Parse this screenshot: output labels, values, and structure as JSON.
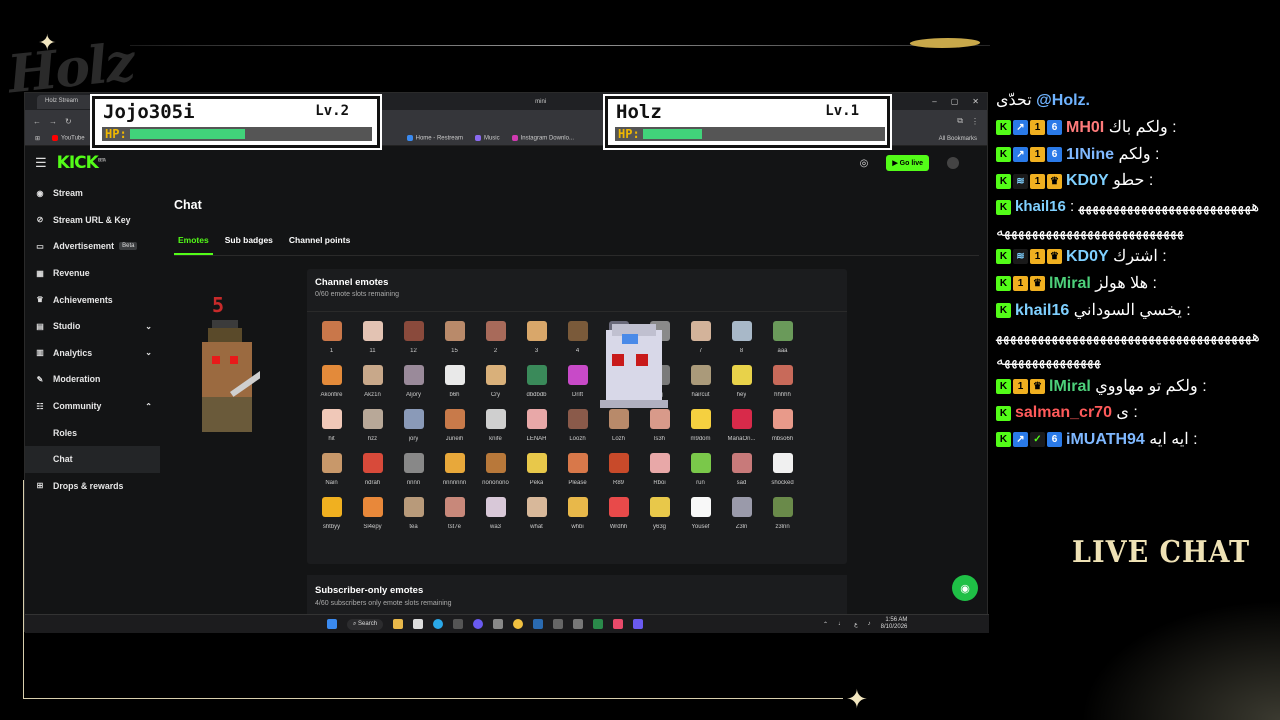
{
  "overlay": {
    "logo_text": "Holz",
    "live_chat_label": "LIVE CHAT",
    "player1": {
      "name": "Jojo305i",
      "level": "Lv.2",
      "hp_label": "HP:",
      "hp_fraction": 0.5
    },
    "player2": {
      "name": "Holz",
      "level": "Lv.1",
      "hp_label": "HP:",
      "hp_fraction": 0.26
    },
    "warrior_number": "5"
  },
  "browser": {
    "tab_title": "Holz Stream",
    "other_tab": "mini",
    "bookmarks": [
      "YouTube",
      "Home - Restream",
      "Music",
      "Instagram Downlo...",
      "All Bookmarks"
    ],
    "window_controls": [
      "–",
      "▢",
      "✕"
    ]
  },
  "kick": {
    "logo": "KICK",
    "logo_beta": "BETA",
    "go_live": "Go live",
    "sidebar": [
      {
        "label": "Stream",
        "icon": "stream-icon",
        "glyph": "◉"
      },
      {
        "label": "Stream URL & Key",
        "icon": "link-icon",
        "glyph": "⊘"
      },
      {
        "label": "Advertisement",
        "icon": "ad-icon",
        "glyph": "▭",
        "badge": "Beta"
      },
      {
        "label": "Revenue",
        "icon": "revenue-icon",
        "glyph": "▦"
      },
      {
        "label": "Achievements",
        "icon": "trophy-icon",
        "glyph": "♛"
      },
      {
        "label": "Studio",
        "icon": "studio-icon",
        "glyph": "▤",
        "chevron": "⌄"
      },
      {
        "label": "Analytics",
        "icon": "analytics-icon",
        "glyph": "▥",
        "chevron": "⌄"
      },
      {
        "label": "Moderation",
        "icon": "wrench-icon",
        "glyph": "✎"
      },
      {
        "label": "Community",
        "icon": "community-icon",
        "glyph": "☷",
        "chevron": "⌃"
      },
      {
        "label": "Roles",
        "sub": true
      },
      {
        "label": "Chat",
        "sub": true,
        "active": true
      },
      {
        "label": "Drops & rewards",
        "icon": "gift-icon",
        "glyph": "⊞"
      }
    ],
    "page_title": "Chat",
    "tabs": [
      "Emotes",
      "Sub badges",
      "Channel points"
    ],
    "active_tab": "Emotes",
    "channel_emotes": {
      "title": "Channel emotes",
      "subtitle": "0/60 emote slots remaining",
      "items": [
        {
          "name": "1",
          "color": "#c9774a"
        },
        {
          "name": "11",
          "color": "#e3c3b3"
        },
        {
          "name": "12",
          "color": "#8a4a3c"
        },
        {
          "name": "15",
          "color": "#b98a6a"
        },
        {
          "name": "2",
          "color": "#a86a5a"
        },
        {
          "name": "3",
          "color": "#d9a76a"
        },
        {
          "name": "4",
          "color": "#7a5a3a"
        },
        {
          "name": "5",
          "color": "#6a6a7a"
        },
        {
          "name": "6",
          "color": "#8a8a8a"
        },
        {
          "name": "7",
          "color": "#d3b39a"
        },
        {
          "name": "8",
          "color": "#a8b8c8"
        },
        {
          "name": "aaa",
          "color": "#6a9a5a"
        },
        {
          "name": "Akonfire",
          "color": "#e38a3a"
        },
        {
          "name": "Akz1n",
          "color": "#c8a88a"
        },
        {
          "name": "Aljory",
          "color": "#9a8a9a"
        },
        {
          "name": "b6h",
          "color": "#e9e9e9"
        },
        {
          "name": "Cry",
          "color": "#d9b07a"
        },
        {
          "name": "dbdbdb",
          "color": "#3a8a5a"
        },
        {
          "name": "Drift",
          "color": "#c84ac8"
        },
        {
          "name": "Foxy",
          "color": "#5a5a6a"
        },
        {
          "name": "gg",
          "color": "#7a7a7a"
        },
        {
          "name": "haircut",
          "color": "#aa9a7a"
        },
        {
          "name": "hey",
          "color": "#e8d24a"
        },
        {
          "name": "hhhhh",
          "color": "#c86a5a"
        },
        {
          "name": "hit",
          "color": "#f0c8b8"
        },
        {
          "name": "hzz",
          "color": "#b8a898"
        },
        {
          "name": "jory",
          "color": "#8a9ab8"
        },
        {
          "name": "Juneih",
          "color": "#c87a4a"
        },
        {
          "name": "knife",
          "color": "#cfcfcf"
        },
        {
          "name": "LENAH",
          "color": "#e8a8a8"
        },
        {
          "name": "Loozh",
          "color": "#8a5a4a"
        },
        {
          "name": "Lozh",
          "color": "#b88a6a"
        },
        {
          "name": "ls3h",
          "color": "#d89a8a"
        },
        {
          "name": "m9dom",
          "color": "#f5d040"
        },
        {
          "name": "ManaOn...",
          "color": "#d82a4a"
        },
        {
          "name": "mbso6h",
          "color": "#e89a8a"
        },
        {
          "name": "Nain",
          "color": "#c8986a"
        },
        {
          "name": "ndrah",
          "color": "#d84a3a"
        },
        {
          "name": "nnnn",
          "color": "#888888"
        },
        {
          "name": "nnnnnnn",
          "color": "#e8a83a"
        },
        {
          "name": "nononono",
          "color": "#b8783a"
        },
        {
          "name": "Peka",
          "color": "#e8c84a"
        },
        {
          "name": "Please",
          "color": "#d8784a"
        },
        {
          "name": "R89",
          "color": "#c84a2a"
        },
        {
          "name": "Rboi",
          "color": "#e8a8a8"
        },
        {
          "name": "run",
          "color": "#7ac84a"
        },
        {
          "name": "sad",
          "color": "#c87a7a"
        },
        {
          "name": "shocked",
          "color": "#f0f0f0"
        },
        {
          "name": "shtbyy",
          "color": "#f0b020"
        },
        {
          "name": "Sl4epy",
          "color": "#e8883a"
        },
        {
          "name": "tea",
          "color": "#b89a7a"
        },
        {
          "name": "tst7e",
          "color": "#c8887a"
        },
        {
          "name": "wa3",
          "color": "#d8c8d8"
        },
        {
          "name": "what",
          "color": "#d8b89a"
        },
        {
          "name": "whbi",
          "color": "#e8b84a"
        },
        {
          "name": "Wrdhh",
          "color": "#e84a4a"
        },
        {
          "name": "y63g",
          "color": "#e8c84a"
        },
        {
          "name": "Yousef",
          "color": "#f8f8f8"
        },
        {
          "name": "Z3ln",
          "color": "#9a9aaa"
        },
        {
          "name": "z3lnn",
          "color": "#6a8a4a"
        }
      ]
    },
    "subscriber_emotes": {
      "title": "Subscriber-only emotes",
      "subtitle": "4/60 subscribers only emote slots remaining"
    }
  },
  "taskbar": {
    "search": "Search",
    "time": "1:56 AM",
    "date": "8/10/2026",
    "lang": "ع"
  },
  "chat": [
    {
      "user": "@Holz.",
      "text": "تحدّى ",
      "badges": [],
      "user_color": "#6fb3ff",
      "rtl_first": true
    },
    {
      "user": "MH0I",
      "text": "ولكم باك : ",
      "badges": [
        "K",
        "A",
        "1",
        "6"
      ],
      "user_color": "#ff7b7b"
    },
    {
      "user": "1INine",
      "text": "ولكم : ",
      "badges": [
        "K",
        "A",
        "1",
        "6"
      ],
      "user_color": "#7fb8ff"
    },
    {
      "user": "KD0Y",
      "text": "حطو : ",
      "badges": [
        "K",
        "W",
        "1",
        "C"
      ],
      "user_color": "#7fd0ff"
    },
    {
      "user": "khail16",
      "text": ": ههههههههههههههههههههههههههههههههههههههههههههههههههههه",
      "badges": [
        "K"
      ],
      "user_color": "#7fd0ff",
      "wrap": true
    },
    {
      "user": "KD0Y",
      "text": "اشترك : ",
      "badges": [
        "K",
        "W",
        "1",
        "C"
      ],
      "user_color": "#7fd0ff"
    },
    {
      "user": "lMiral",
      "text": "هلا هولز : ",
      "badges": [
        "K",
        "1",
        "C"
      ],
      "user_color": "#4dd07a"
    },
    {
      "user": "khail16",
      "text": "يخسي السوداني : ",
      "badges": [
        "K"
      ],
      "user_color": "#7fd0ff"
    },
    {
      "user": "",
      "text": "ههههههههههههههههههههههههههههههههههههههههههههههههههههه",
      "badges": [],
      "user_color": "#fff",
      "wrap": true
    },
    {
      "user": "lMiral",
      "text": "ولكم تو مهاووي : ",
      "badges": [
        "K",
        "1",
        "C"
      ],
      "user_color": "#4dd07a"
    },
    {
      "user": "salman_cr70",
      "text": "ى : ",
      "badges": [
        "K"
      ],
      "user_color": "#ff5a5a"
    },
    {
      "user": "iMUATH94",
      "text": "ايه ايه : ",
      "badges": [
        "K",
        "A",
        "G",
        "6"
      ],
      "user_color": "#7fb8ff"
    }
  ]
}
